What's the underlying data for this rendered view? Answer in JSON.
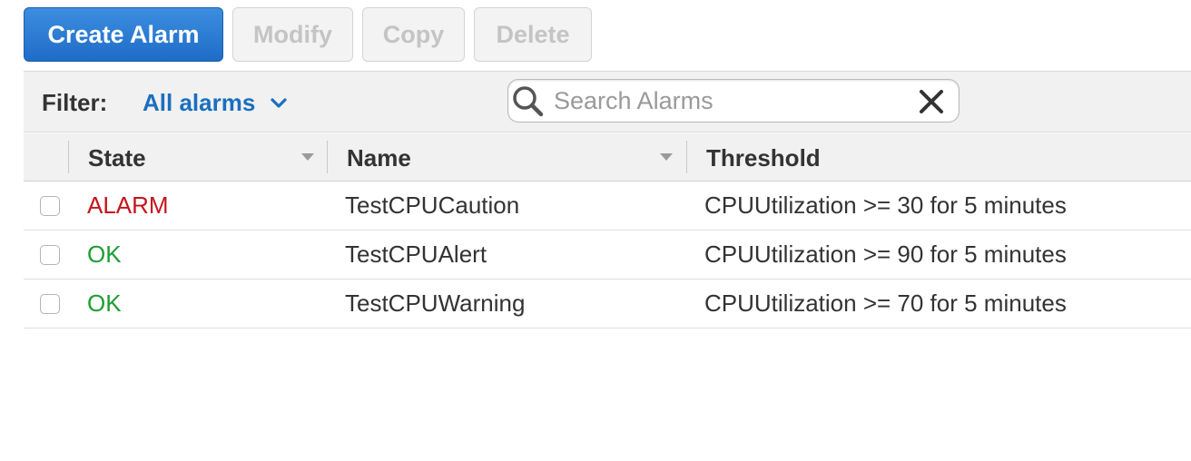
{
  "toolbar": {
    "create_label": "Create Alarm",
    "modify_label": "Modify",
    "copy_label": "Copy",
    "delete_label": "Delete"
  },
  "filter": {
    "label": "Filter:",
    "value": "All alarms",
    "search_placeholder": "Search Alarms",
    "search_value": ""
  },
  "table": {
    "columns": [
      "State",
      "Name",
      "Threshold"
    ],
    "rows": [
      {
        "state": "ALARM",
        "name": "TestCPUCaution",
        "threshold": "CPUUtilization >= 30 for 5 minutes"
      },
      {
        "state": "OK",
        "name": "TestCPUAlert",
        "threshold": "CPUUtilization >= 90 for 5 minutes"
      },
      {
        "state": "OK",
        "name": "TestCPUWarning",
        "threshold": "CPUUtilization >= 70 for 5 minutes"
      }
    ]
  },
  "icons": {
    "search": "search-icon",
    "clear": "close-icon",
    "dropdown": "chevron-down-icon",
    "sort": "sort-caret-icon"
  },
  "colors": {
    "primary": "#1f6cc7",
    "link": "#1a6fbf",
    "alarm": "#c4161c",
    "ok": "#1d9d32"
  }
}
